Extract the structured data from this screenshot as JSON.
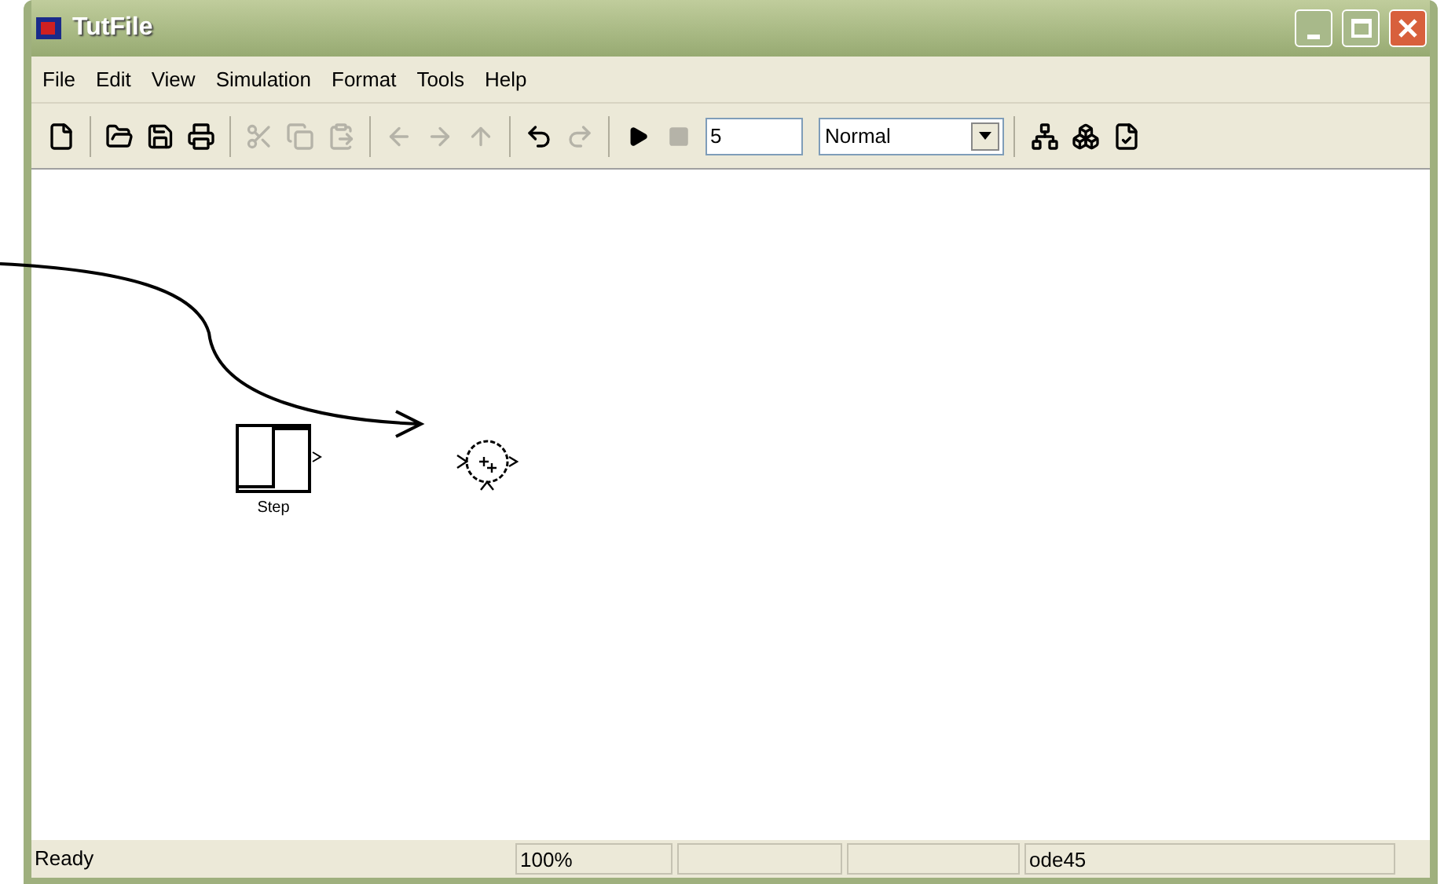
{
  "window": {
    "title": "TutFile"
  },
  "menu": [
    "File",
    "Edit",
    "View",
    "Simulation",
    "Format",
    "Tools",
    "Help"
  ],
  "toolbar": [
    [
      {
        "kind": "new",
        "disabled": false
      }
    ],
    [
      {
        "kind": "open",
        "disabled": false
      },
      {
        "kind": "save",
        "disabled": false
      },
      {
        "kind": "print",
        "disabled": false
      }
    ],
    [
      {
        "kind": "cut",
        "disabled": true
      },
      {
        "kind": "copy",
        "disabled": true
      },
      {
        "kind": "paste",
        "disabled": true
      }
    ],
    [
      {
        "kind": "back",
        "disabled": true
      },
      {
        "kind": "forward",
        "disabled": true
      },
      {
        "kind": "up",
        "disabled": true
      }
    ],
    [
      {
        "kind": "undo",
        "disabled": false
      },
      {
        "kind": "redo",
        "disabled": true
      }
    ],
    [
      {
        "kind": "start",
        "disabled": false
      },
      {
        "kind": "stop",
        "disabled": true
      }
    ]
  ],
  "stop_time": {
    "value": "5"
  },
  "sim_mode": {
    "value": "Normal"
  },
  "tools": [
    {
      "kind": "library"
    },
    {
      "kind": "explorer"
    },
    {
      "kind": "debug"
    }
  ],
  "blocks": [
    {
      "kind": "step",
      "label": "Step"
    },
    {
      "kind": "sum"
    }
  ],
  "status_bar": {
    "message": "Ready",
    "zoom": "100%",
    "solver": "ode45"
  }
}
